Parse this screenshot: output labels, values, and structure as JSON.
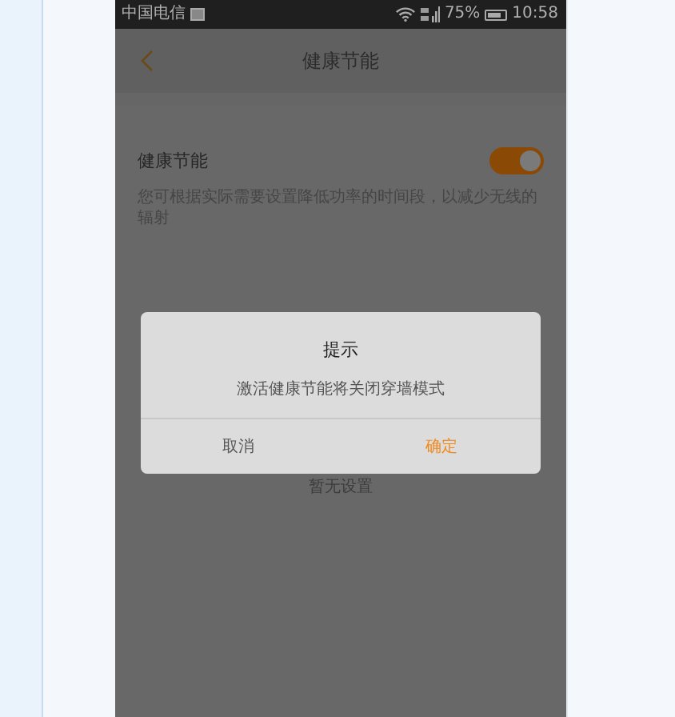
{
  "status_bar": {
    "carrier": "中国电信",
    "battery": "75%",
    "time": "10:58"
  },
  "header": {
    "title": "健康节能"
  },
  "setting": {
    "label": "健康节能",
    "on": true,
    "description": "您可根据实际需要设置降低功率的时间段，以减少无线的辐射"
  },
  "empty_state": {
    "text": "暂无设置"
  },
  "dialog": {
    "title": "提示",
    "message": "激活健康节能将关闭穿墙模式",
    "buttons": [
      {
        "label": "取消",
        "kind": "cancel"
      },
      {
        "label": "确定",
        "kind": "confirm"
      }
    ]
  }
}
